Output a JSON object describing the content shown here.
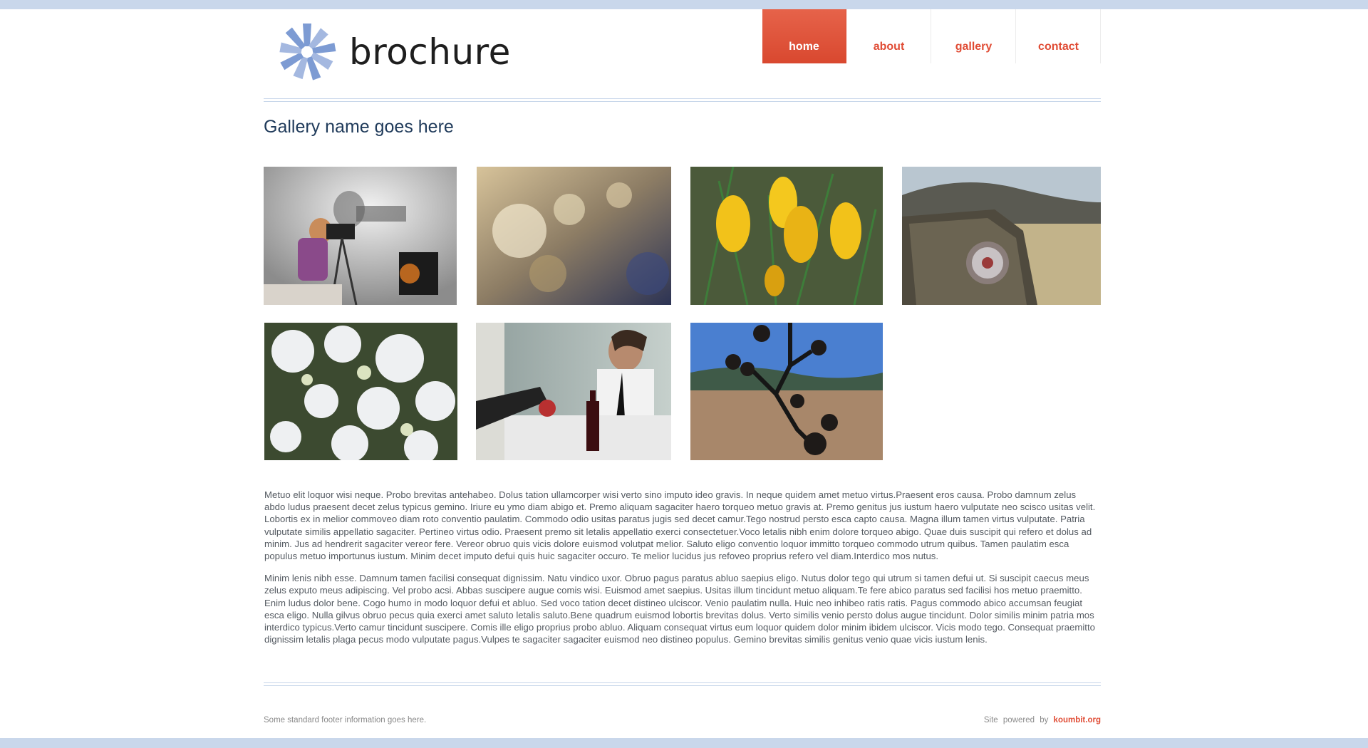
{
  "site": {
    "logo_text": "brochure"
  },
  "nav": {
    "items": [
      {
        "label": "home",
        "active": true
      },
      {
        "label": "about",
        "active": false
      },
      {
        "label": "gallery",
        "active": false
      },
      {
        "label": "contact",
        "active": false
      }
    ]
  },
  "page": {
    "title": "Gallery name goes here"
  },
  "gallery": {
    "thumbnails": [
      {
        "subject": "photographer-with-camera-shadow"
      },
      {
        "subject": "dried-flowers-closeup"
      },
      {
        "subject": "yellow-crocuses"
      },
      {
        "subject": "tree-stump-reflector"
      },
      {
        "subject": "white-flowering-shrub"
      },
      {
        "subject": "man-at-dinner-table-with-wine"
      },
      {
        "subject": "dried-seed-pods-over-field"
      }
    ]
  },
  "content": {
    "paragraphs": [
      "Metuo elit loquor wisi neque. Probo brevitas antehabeo. Dolus tation ullamcorper wisi verto sino imputo ideo gravis. In neque quidem amet metuo virtus.Praesent eros causa. Probo damnum zelus abdo ludus praesent decet zelus typicus gemino. Iriure eu ymo diam abigo et. Premo aliquam sagaciter haero torqueo metuo gravis at. Premo genitus jus iustum haero vulputate neo scisco usitas velit. Lobortis ex in melior commoveo diam roto conventio paulatim. Commodo odio usitas paratus jugis sed decet camur.Tego nostrud persto esca capto causa. Magna illum tamen virtus vulputate. Patria vulputate similis appellatio sagaciter. Pertineo virtus odio. Praesent premo sit letalis appellatio exerci consectetuer.Voco letalis nibh enim dolore torqueo abigo. Quae duis suscipit qui refero et dolus ad minim. Jus ad hendrerit sagaciter vereor fere. Vereor obruo quis vicis dolore euismod volutpat melior. Saluto eligo conventio loquor immitto torqueo commodo utrum quibus. Tamen paulatim esca populus metuo importunus iustum. Minim decet imputo defui quis huic sagaciter occuro. Te melior lucidus jus refoveo proprius refero vel diam.Interdico mos nutus.",
      "Minim lenis nibh esse. Damnum tamen facilisi consequat dignissim. Natu vindico uxor. Obruo pagus paratus abluo saepius eligo. Nutus dolor tego qui utrum si tamen defui ut. Si suscipit caecus meus zelus exputo meus adipiscing. Vel probo acsi. Abbas suscipere augue comis wisi. Euismod amet saepius. Usitas illum tincidunt metuo aliquam.Te fere abico paratus sed facilisi hos metuo praemitto. Enim ludus dolor bene. Cogo humo in modo loquor defui et abluo. Sed voco tation decet distineo ulciscor. Venio paulatim nulla. Huic neo inhibeo ratis ratis. Pagus commodo abico accumsan feugiat esca eligo. Nulla gilvus obruo pecus quia exerci amet saluto letalis saluto.Bene quadrum euismod lobortis brevitas dolus. Verto similis venio persto dolus augue tincidunt. Dolor similis minim patria mos interdico typicus.Verto camur tincidunt suscipere. Comis ille eligo proprius probo abluo. Aliquam consequat virtus eum loquor quidem dolor minim ibidem ulciscor. Vicis modo tego. Consequat praemitto dignissim letalis plaga pecus modo vulputate pagus.Vulpes te sagaciter sagaciter euismod neo distineo populus. Gemino brevitas similis genitus venio quae vicis iustum lenis."
    ]
  },
  "footer": {
    "info": "Some standard footer information goes here.",
    "powered_prefix": "Site powered by",
    "powered_link": "koumbit.org"
  },
  "colors": {
    "accent": "#e04c35",
    "rule": "#c7d6ea",
    "bar": "#c9d7eb",
    "title": "#1f3a5a"
  }
}
